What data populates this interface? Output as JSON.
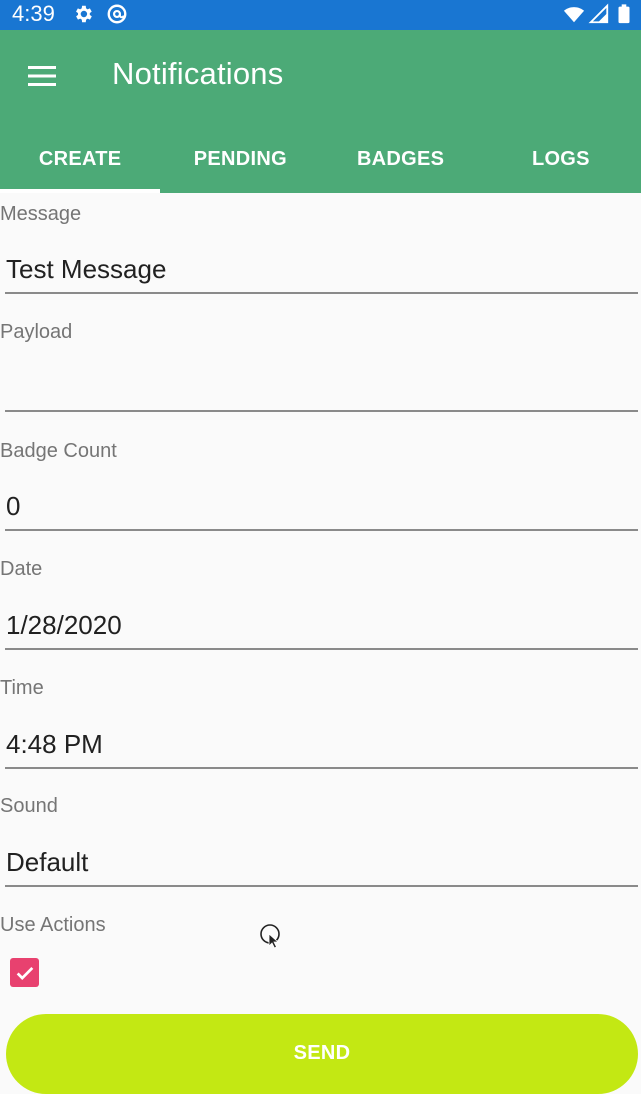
{
  "status_bar": {
    "time": "4:39",
    "icons": [
      "gear-icon",
      "at-sign-icon",
      "wifi-icon",
      "signal-icon",
      "battery-icon"
    ]
  },
  "app_bar": {
    "title": "Notifications",
    "menu_icon": "menu-icon"
  },
  "tabs": [
    {
      "label": "CREATE",
      "selected": true
    },
    {
      "label": "PENDING",
      "selected": false
    },
    {
      "label": "BADGES",
      "selected": false
    },
    {
      "label": "LOGS",
      "selected": false
    }
  ],
  "form": {
    "message": {
      "label": "Message",
      "value": "Test Message"
    },
    "payload": {
      "label": "Payload",
      "value": ""
    },
    "badge_count": {
      "label": "Badge Count",
      "value": "0"
    },
    "date": {
      "label": "Date",
      "value": "1/28/2020"
    },
    "time": {
      "label": "Time",
      "value": "4:48 PM"
    },
    "sound": {
      "label": "Sound",
      "value": "Default"
    },
    "use_actions": {
      "label": "Use Actions",
      "checked": true
    }
  },
  "send_button": {
    "label": "SEND"
  },
  "colors": {
    "status_bar": "#1976d2",
    "app_bar": "#4caa77",
    "checkbox": "#e8416f",
    "send_button": "#c3e813"
  }
}
